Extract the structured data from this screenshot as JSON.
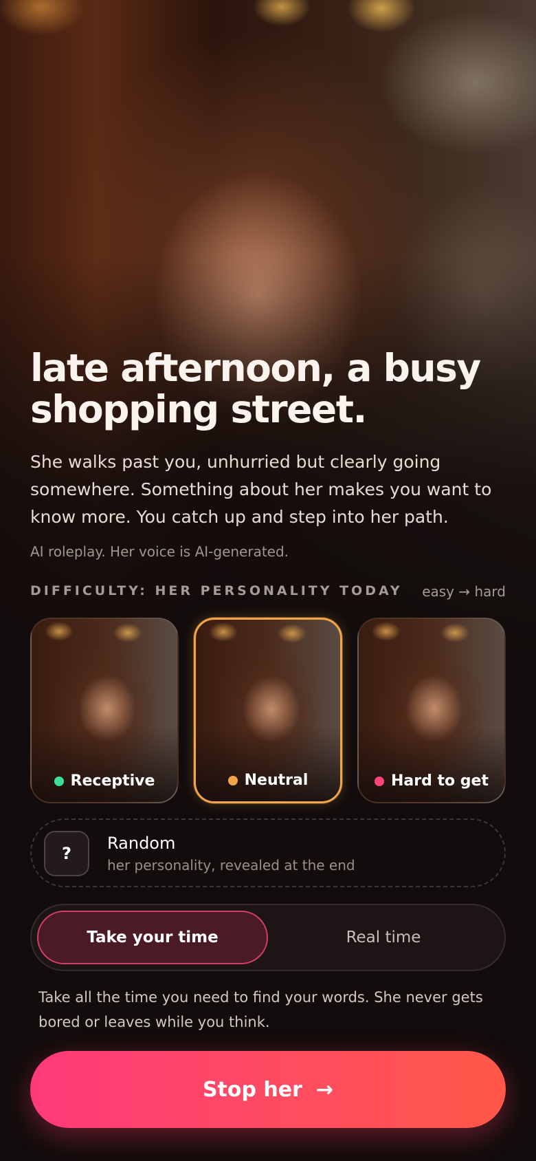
{
  "scene": {
    "title": "late afternoon, a busy shopping street.",
    "description": "She walks past you, unhurried but clearly going somewhere. Something about her makes you want to know more. You catch up and step into her path.",
    "disclaimer": "AI roleplay. Her voice is AI-generated."
  },
  "difficulty": {
    "label": "DIFFICULTY: HER PERSONALITY TODAY",
    "scale": "easy → hard",
    "options": [
      {
        "label": "Receptive",
        "dot_color": "#3ddc97",
        "selected": false
      },
      {
        "label": "Neutral",
        "dot_color": "#f2a54a",
        "selected": true
      },
      {
        "label": "Hard to get",
        "dot_color": "#ff4577",
        "selected": false
      }
    ],
    "random": {
      "icon": "?",
      "title": "Random",
      "subtitle": "her personality, revealed at the end"
    }
  },
  "mode": {
    "options": [
      "Take your time",
      "Real time"
    ],
    "selected": "Take your time",
    "description": "Take all the time you need to find your words. She never gets bored or leaves while you think."
  },
  "cta": {
    "label": "Stop her",
    "icon": "arrow-right-icon"
  },
  "colors": {
    "accent": "#ff4a6e",
    "selected_border": "#f2a54a",
    "toggle_active_border": "#d63f68"
  }
}
